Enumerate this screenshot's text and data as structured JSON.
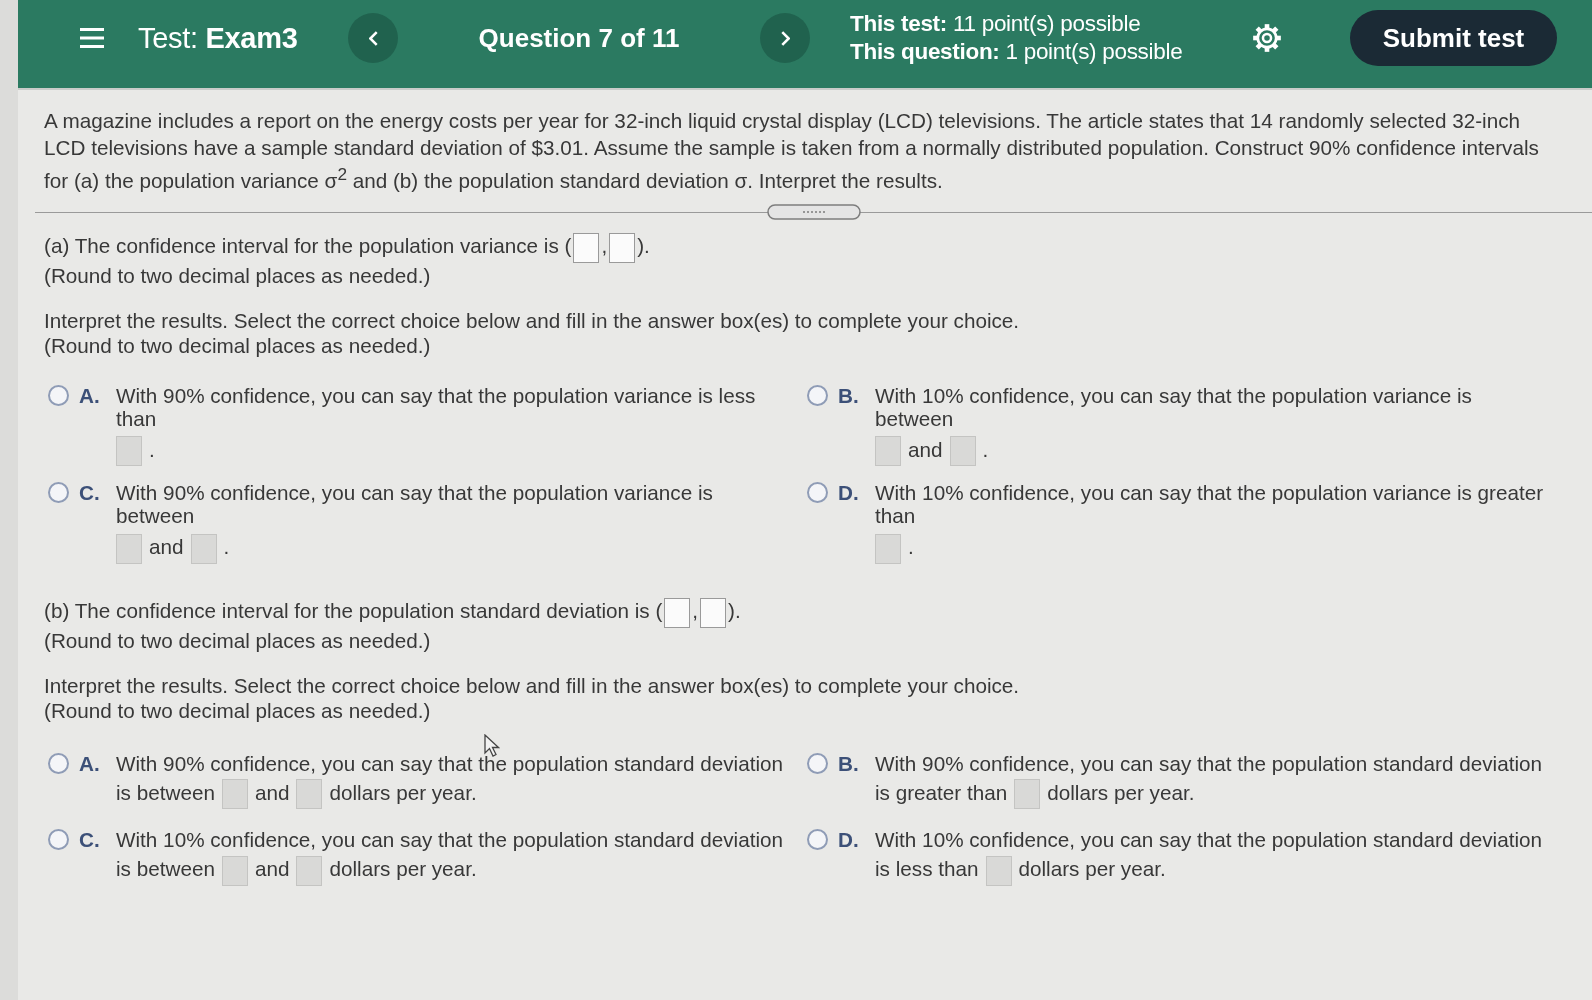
{
  "header": {
    "title": "Test: **Exam3**",
    "question": "Question 7 of 11",
    "points": [
      "**This test:** 11 point(s) possible",
      "**This question:** 1 point(s) possible"
    ],
    "submit": "Submit test"
  },
  "problem": "A magazine includes a report on the energy costs per year for 32-inch liquid crystal display (LCD) televisions. The article states that 14 randomly selected 32-inch LCD televisions have a sample standard deviation of $3.01. Assume the sample is taken from a normally distributed population. Construct 90% confidence intervals for (a) the population variance σ$^{2}$ and (b) the population standard deviation σ. Interpret the results.",
  "parts": [
    {
      "prompt": [
        {
          "kind": "text",
          "text": "(a) The confidence interval for the population variance is ("
        },
        {
          "kind": "box",
          "disabled": false
        },
        {
          "kind": "text",
          "text": ","
        },
        {
          "kind": "box",
          "disabled": false
        },
        {
          "kind": "text",
          "text": ")."
        }
      ],
      "hint": "(Round to two decimal places as needed.)",
      "instruction": "Interpret the results. Select the correct choice below and fill in the answer box(es) to complete your choice.",
      "instruction_hint": "(Round to two decimal places as needed.)",
      "choices": [
        {
          "letter": "A.",
          "selected": false,
          "lines": [
            [
              {
                "kind": "text",
                "text": "With 90% confidence, you can say that the population variance is less than"
              }
            ],
            [
              {
                "kind": "box",
                "disabled": true
              },
              {
                "kind": "text",
                "text": "."
              }
            ]
          ]
        },
        {
          "letter": "B.",
          "selected": false,
          "lines": [
            [
              {
                "kind": "text",
                "text": "With 10% confidence, you can say that the population variance is between"
              }
            ],
            [
              {
                "kind": "box",
                "disabled": true
              },
              {
                "kind": "text",
                "text": "and"
              },
              {
                "kind": "box",
                "disabled": true
              },
              {
                "kind": "text",
                "text": "."
              }
            ]
          ]
        },
        {
          "letter": "C.",
          "selected": false,
          "lines": [
            [
              {
                "kind": "text",
                "text": "With 90% confidence, you can say that the population variance is between"
              }
            ],
            [
              {
                "kind": "box",
                "disabled": true
              },
              {
                "kind": "text",
                "text": "and"
              },
              {
                "kind": "box",
                "disabled": true
              },
              {
                "kind": "text",
                "text": "."
              }
            ]
          ]
        },
        {
          "letter": "D.",
          "selected": false,
          "lines": [
            [
              {
                "kind": "text",
                "text": "With 10% confidence, you can say that the population variance is greater than"
              }
            ],
            [
              {
                "kind": "box",
                "disabled": true
              },
              {
                "kind": "text",
                "text": "."
              }
            ]
          ]
        }
      ]
    },
    {
      "prompt": [
        {
          "kind": "text",
          "text": "(b) The confidence interval for the population standard deviation is ("
        },
        {
          "kind": "box",
          "disabled": false
        },
        {
          "kind": "text",
          "text": ","
        },
        {
          "kind": "box",
          "disabled": false
        },
        {
          "kind": "text",
          "text": ")."
        }
      ],
      "hint": "(Round to two decimal places as needed.)",
      "instruction": "Interpret the results. Select the correct choice below and fill in the answer box(es) to complete your choice.",
      "instruction_hint": "(Round to two decimal places as needed.)",
      "choices": [
        {
          "letter": "A.",
          "selected": false,
          "lines": [
            [
              {
                "kind": "text",
                "text": "With 90% confidence, you can say that the population standard deviation"
              }
            ],
            [
              {
                "kind": "text",
                "text": "is between"
              },
              {
                "kind": "box",
                "disabled": true
              },
              {
                "kind": "text",
                "text": "and"
              },
              {
                "kind": "box",
                "disabled": true
              },
              {
                "kind": "text",
                "text": "dollars per year."
              }
            ]
          ]
        },
        {
          "letter": "B.",
          "selected": false,
          "lines": [
            [
              {
                "kind": "text",
                "text": "With 90% confidence, you can say that the population standard deviation"
              }
            ],
            [
              {
                "kind": "text",
                "text": "is greater than"
              },
              {
                "kind": "box",
                "disabled": true
              },
              {
                "kind": "text",
                "text": "dollars per year."
              }
            ]
          ]
        },
        {
          "letter": "C.",
          "selected": false,
          "lines": [
            [
              {
                "kind": "text",
                "text": "With 10% confidence, you can say that the population standard deviation"
              }
            ],
            [
              {
                "kind": "text",
                "text": "is between"
              },
              {
                "kind": "box",
                "disabled": true
              },
              {
                "kind": "text",
                "text": "and"
              },
              {
                "kind": "box",
                "disabled": true
              },
              {
                "kind": "text",
                "text": "dollars per year."
              }
            ]
          ]
        },
        {
          "letter": "D.",
          "selected": false,
          "lines": [
            [
              {
                "kind": "text",
                "text": "With 10% confidence, you can say that the population standard deviation"
              }
            ],
            [
              {
                "kind": "text",
                "text": "is less than"
              },
              {
                "kind": "box",
                "disabled": true
              },
              {
                "kind": "text",
                "text": "dollars per year."
              }
            ]
          ]
        }
      ]
    }
  ]
}
